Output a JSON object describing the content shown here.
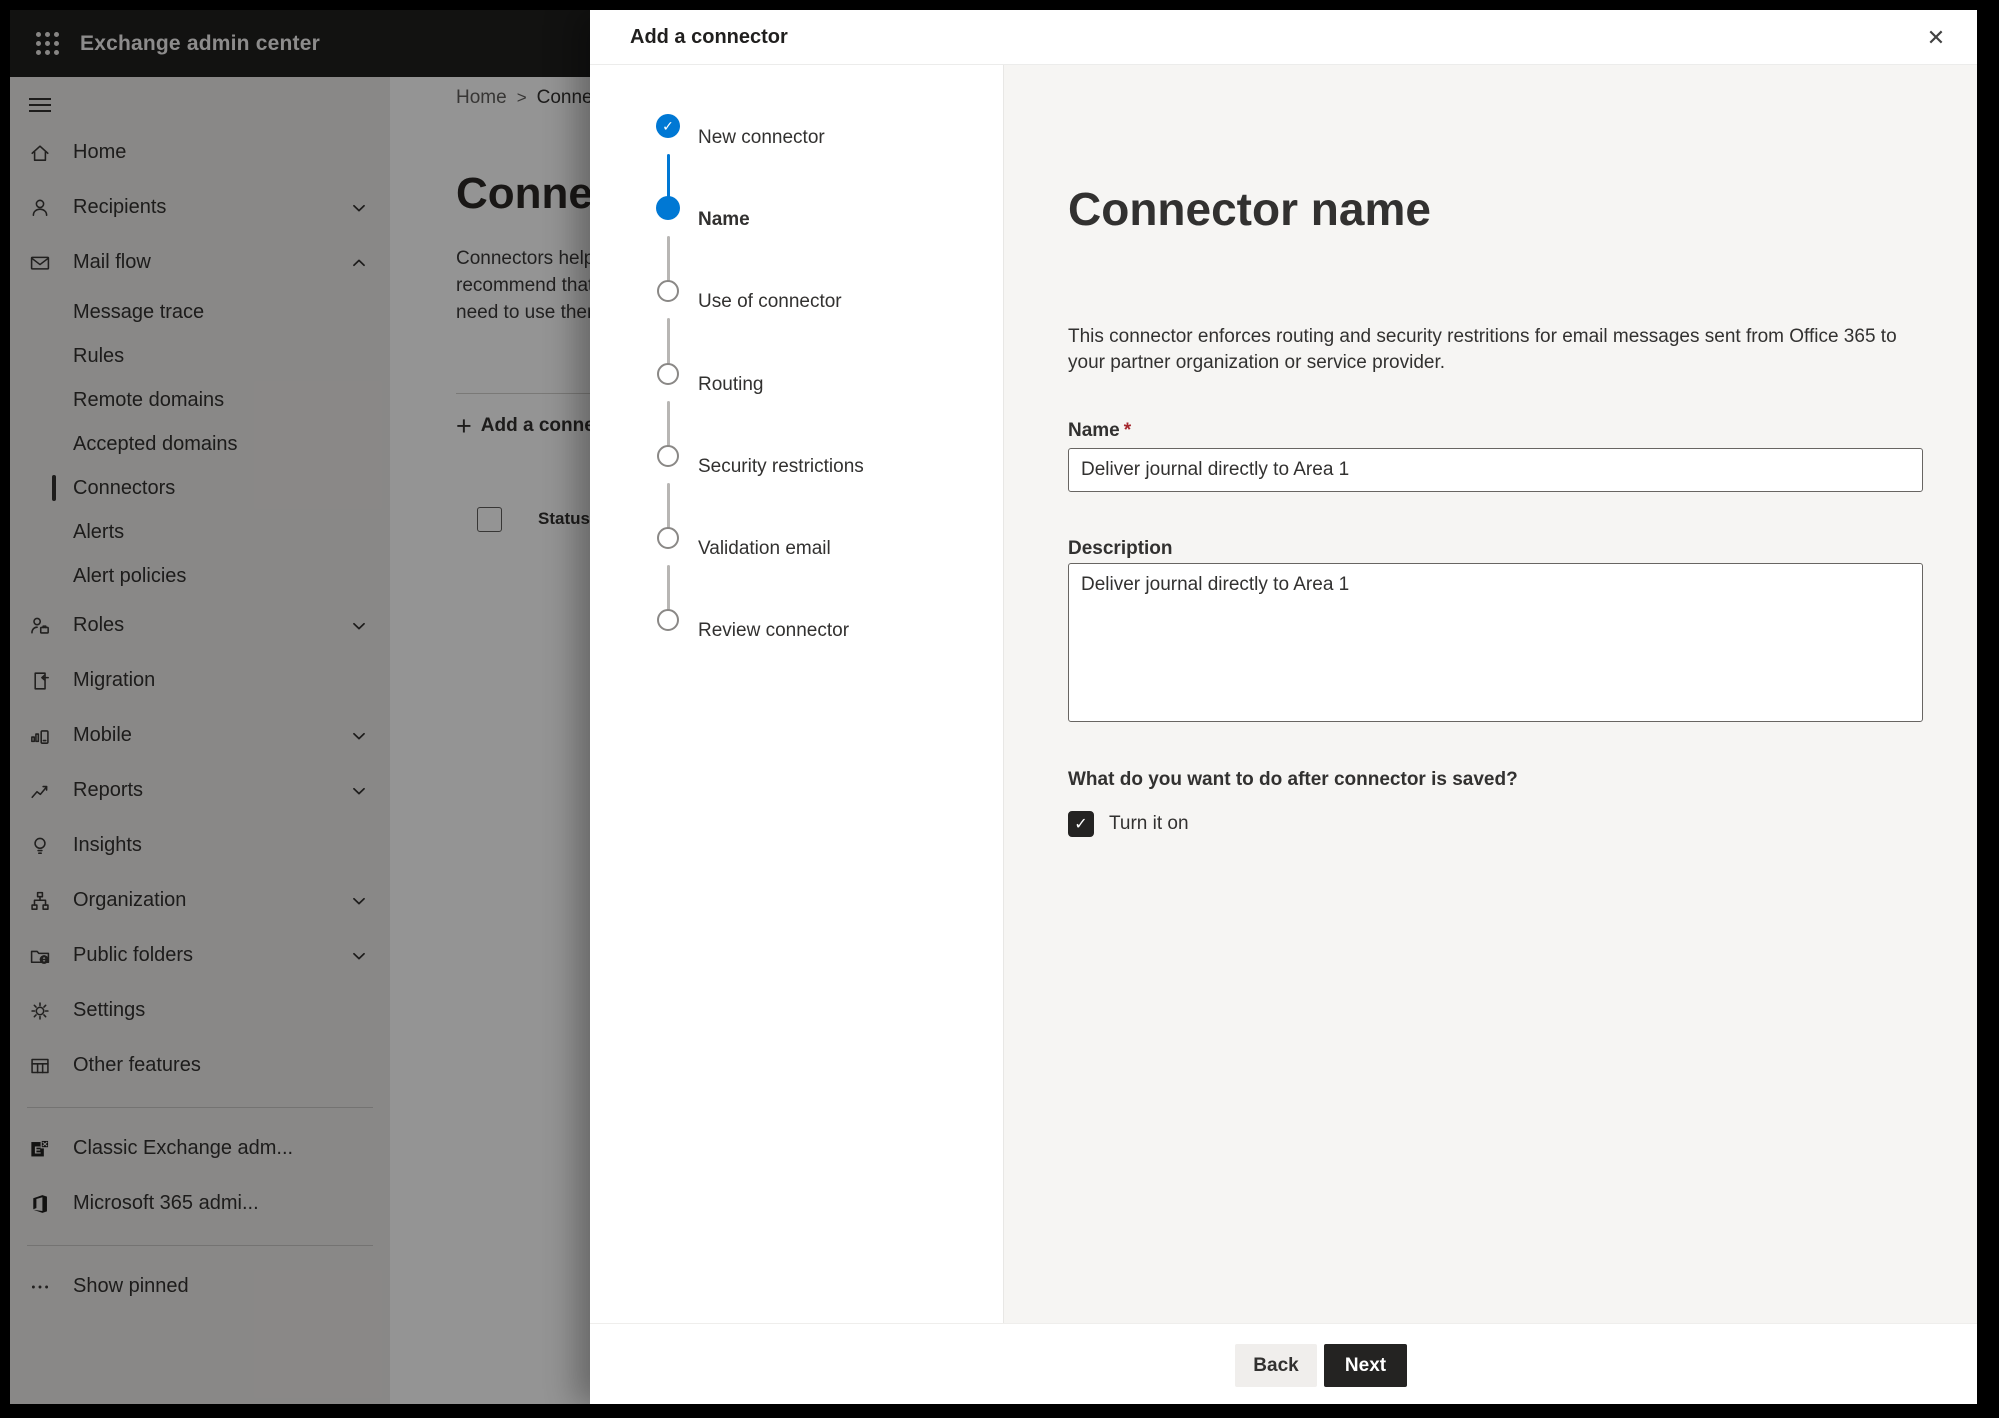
{
  "topbar": {
    "title": "Exchange admin center"
  },
  "sidebar": {
    "items": [
      {
        "label": "Home",
        "icon": "home"
      },
      {
        "label": "Recipients",
        "icon": "person",
        "chevron": "down"
      },
      {
        "label": "Mail flow",
        "icon": "mail",
        "chevron": "up"
      },
      {
        "label": "Message trace",
        "sub": true
      },
      {
        "label": "Rules",
        "sub": true
      },
      {
        "label": "Remote domains",
        "sub": true
      },
      {
        "label": "Accepted domains",
        "sub": true
      },
      {
        "label": "Connectors",
        "sub": true,
        "selected": true
      },
      {
        "label": "Alerts",
        "sub": true
      },
      {
        "label": "Alert policies",
        "sub": true
      },
      {
        "label": "Roles",
        "icon": "roles",
        "chevron": "down"
      },
      {
        "label": "Migration",
        "icon": "migration"
      },
      {
        "label": "Mobile",
        "icon": "mobile",
        "chevron": "down"
      },
      {
        "label": "Reports",
        "icon": "reports",
        "chevron": "down"
      },
      {
        "label": "Insights",
        "icon": "insights"
      },
      {
        "label": "Organization",
        "icon": "organization",
        "chevron": "down"
      },
      {
        "label": "Public folders",
        "icon": "folders",
        "chevron": "down"
      },
      {
        "label": "Settings",
        "icon": "settings"
      },
      {
        "label": "Other features",
        "icon": "grid"
      },
      {
        "divider": true
      },
      {
        "label": "Classic Exchange adm...",
        "icon": "exchange"
      },
      {
        "label": "Microsoft 365 admi...",
        "icon": "office"
      },
      {
        "divider": true
      },
      {
        "label": "Show pinned",
        "icon": "ellipsis"
      }
    ]
  },
  "page": {
    "breadcrumb": {
      "home": "Home",
      "separator": ">",
      "current": "Connectors"
    },
    "title": "Connectors",
    "intro_lines": [
      "Connectors help",
      "recommend that",
      "need to use ther"
    ],
    "toolbar": {
      "add_label": "Add a connector"
    },
    "table": {
      "status_header": "Status"
    }
  },
  "modal": {
    "title": "Add a connector",
    "close_glyph": "✕",
    "steps": [
      {
        "label": "New connector",
        "state": "complete"
      },
      {
        "label": "Name",
        "state": "current"
      },
      {
        "label": "Use of connector",
        "state": "upcoming"
      },
      {
        "label": "Routing",
        "state": "upcoming"
      },
      {
        "label": "Security restrictions",
        "state": "upcoming"
      },
      {
        "label": "Validation email",
        "state": "upcoming"
      },
      {
        "label": "Review connector",
        "state": "upcoming"
      }
    ],
    "content": {
      "heading": "Connector name",
      "description": "This connector enforces routing and security restritions for email messages sent from Office 365 to your partner organization or service provider.",
      "name_label": "Name",
      "required_mark": "*",
      "name_value": "Deliver journal directly to Area 1",
      "description_label": "Description",
      "description_value": "Deliver journal directly to Area 1",
      "after_save_question": "What do you want to do after connector is saved?",
      "turn_on_label": "Turn it on",
      "turn_on_checked": true,
      "check_glyph": "✓"
    },
    "footer": {
      "back_label": "Back",
      "next_label": "Next"
    }
  },
  "colors": {
    "accent_blue": "#0078d4",
    "required_red": "#a4262c",
    "next_button_bg": "#242322",
    "back_button_bg": "#f0eeec",
    "topbar_bg": "#201f1e"
  }
}
